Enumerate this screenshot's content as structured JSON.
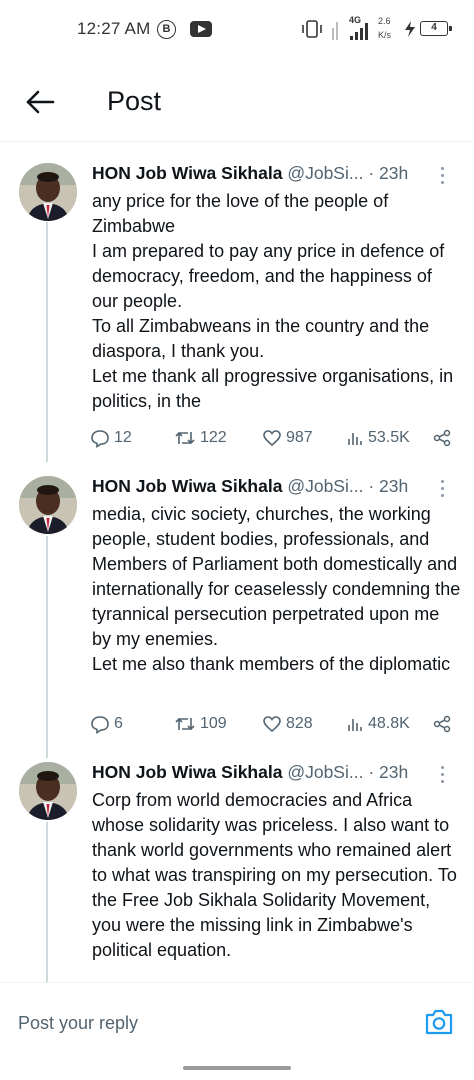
{
  "status_bar": {
    "time": "12:27 AM",
    "b_badge": "B",
    "network": "4G",
    "speed_value": "2.6",
    "speed_unit": "K/s",
    "battery_level": "4"
  },
  "header": {
    "title": "Post",
    "back_icon": "arrow-left-icon"
  },
  "colors": {
    "text": "#0f1419",
    "secondary": "#536471",
    "accent": "#1d9bf0",
    "thread_line": "#cfd9de"
  },
  "tweets": [
    {
      "name": "HON Job Wiwa Sikhala",
      "handle": "@JobSi...",
      "dot": "·",
      "time": "23h",
      "lines": [
        "any price for the love of the people of Zimbabwe",
        "I am prepared to pay any price in defence of democracy, freedom, and the happiness of our people.",
        "To all Zimbabweans in the country and the diaspora, I thank you.",
        "Let me thank all progressive organisations, in politics, in the"
      ],
      "replies": "12",
      "reposts": "122",
      "likes": "987",
      "views": "53.5K"
    },
    {
      "name": "HON Job Wiwa Sikhala",
      "handle": "@JobSi...",
      "dot": "·",
      "time": "23h",
      "lines": [
        "media, civic society, churches, the working people, student bodies, professionals, and Members of Parliament both domestically and internationally for ceaselessly condemning the tyrannical persecution perpetrated upon me by my enemies.",
        "Let me also thank members of the diplomatic"
      ],
      "replies": "6",
      "reposts": "109",
      "likes": "828",
      "views": "48.8K"
    },
    {
      "name": "HON Job Wiwa Sikhala",
      "handle": "@JobSi...",
      "dot": "·",
      "time": "23h",
      "lines": [
        "Corp from world democracies and Africa whose solidarity was priceless. I also want to thank world governments who remained alert to what was transpiring on my persecution. To the Free Job Sikhala Solidarity Movement, you were the missing link in Zimbabwe's political equation."
      ]
    }
  ],
  "reply_bar": {
    "placeholder": "Post your reply",
    "camera_icon": "camera-icon"
  }
}
